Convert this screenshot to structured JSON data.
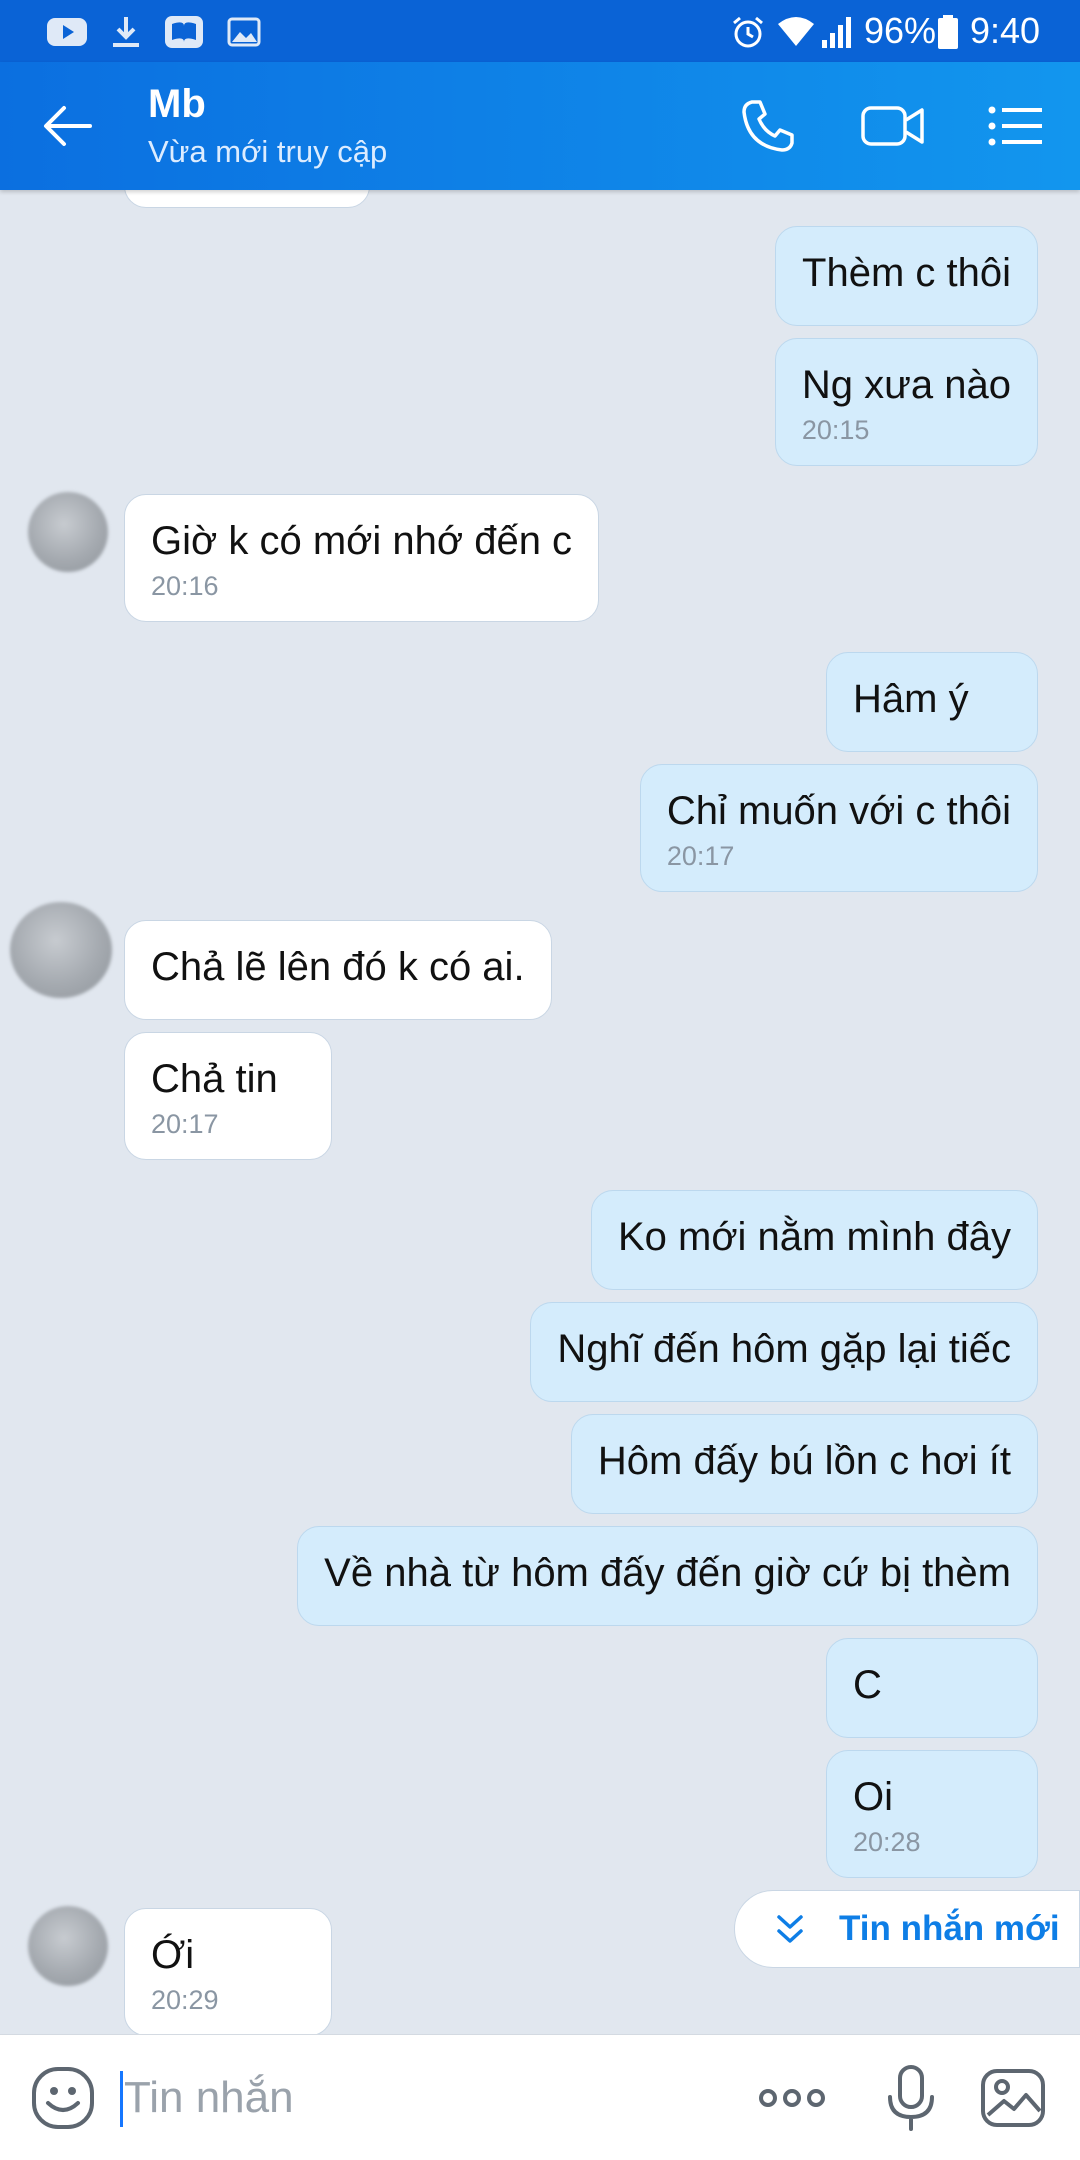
{
  "status_bar": {
    "battery": "96%",
    "time": "9:40",
    "icons": [
      "youtube-icon",
      "download-icon",
      "book-icon",
      "image-icon",
      "alarm-icon",
      "wifi-icon",
      "signal-icon",
      "battery-icon"
    ]
  },
  "header": {
    "title": "Mb",
    "subtitle": "Vừa mới truy cập",
    "icons": [
      "back-arrow-icon",
      "phone-icon",
      "video-call-icon",
      "menu-list-icon"
    ]
  },
  "messages": [
    {
      "dir": "out",
      "text": "Thèm c thôi"
    },
    {
      "dir": "out",
      "text": "Ng xưa nào",
      "time": "20:15"
    },
    {
      "dir": "in",
      "text": "Giờ k có mới nhớ đến c",
      "time": "20:16"
    },
    {
      "dir": "out",
      "text": "Hâm ý"
    },
    {
      "dir": "out",
      "text": "Chỉ muốn với c thôi",
      "time": "20:17"
    },
    {
      "dir": "in",
      "text": "Chả lẽ lên đó k có ai."
    },
    {
      "dir": "in",
      "text": "Chả tin",
      "time": "20:17"
    },
    {
      "dir": "out",
      "text": "Ko mới nằm mình đây"
    },
    {
      "dir": "out",
      "text": "Nghĩ đến hôm gặp lại tiếc"
    },
    {
      "dir": "out",
      "text": "Hôm đấy bú lồn c hơi ít"
    },
    {
      "dir": "out",
      "text": "Về nhà từ hôm đấy đến giờ cứ bị thèm"
    },
    {
      "dir": "out",
      "text": "C"
    },
    {
      "dir": "out",
      "text": "Oi",
      "time": "20:28"
    },
    {
      "dir": "in",
      "text": "Ới",
      "time": "20:29"
    }
  ],
  "new_messages_button": {
    "label": "Tin nhắn mới",
    "icon": "chevron-down-double-icon"
  },
  "input_bar": {
    "placeholder": "Tin nhắn",
    "icons": [
      "emoji-icon",
      "more-dots-icon",
      "microphone-icon",
      "gallery-icon"
    ]
  },
  "colors": {
    "header": "#0b6fe0",
    "outgoing_bubble": "#d4ecfc",
    "incoming_bubble": "#ffffff",
    "chat_background": "#e1e7ef",
    "accent": "#0e7ee6"
  }
}
